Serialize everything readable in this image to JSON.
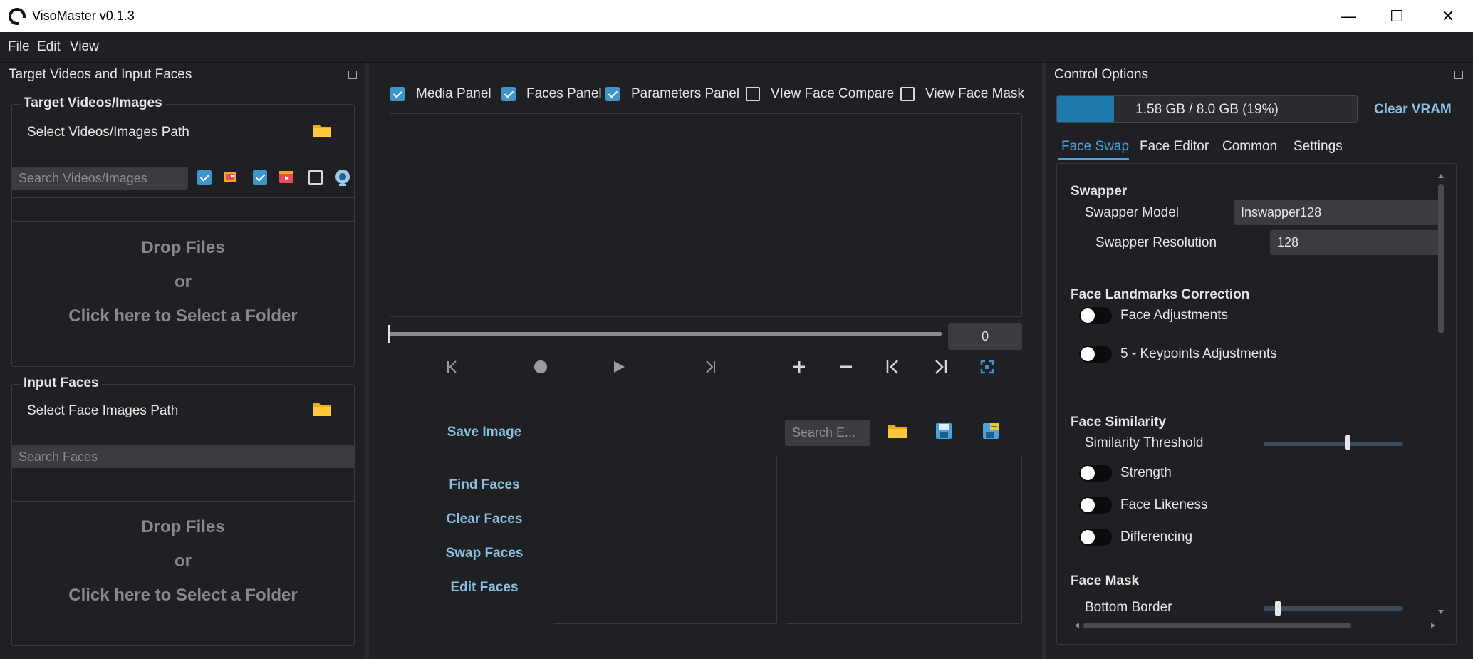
{
  "window": {
    "title": "VisoMaster v0.1.3",
    "minimize": "—",
    "maximize": "☐",
    "close": "✕"
  },
  "menu": [
    "File",
    "Edit",
    "View"
  ],
  "left_panel": {
    "title": "Target Videos and Input Faces",
    "target_group": {
      "title": "Target Videos/Images",
      "path_label": "Select Videos/Images Path"
    },
    "search_videos_placeholder": "Search Videos/Images",
    "drop": {
      "line1": "Drop Files",
      "line2": "or",
      "line3": "Click here to Select a Folder"
    },
    "faces_group": {
      "title": "Input Faces",
      "path_label": "Select Face Images Path"
    },
    "search_faces_placeholder": "Search Faces",
    "drop2": {
      "line1": "Drop Files",
      "line2": "or",
      "line3": "Click here to Select a Folder"
    }
  },
  "center": {
    "checkboxes": [
      {
        "label": "Media Panel",
        "checked": true
      },
      {
        "label": "Faces Panel",
        "checked": true
      },
      {
        "label": "Parameters Panel",
        "checked": true
      },
      {
        "label": "VIew Face Compare",
        "checked": false
      },
      {
        "label": "View Face Mask",
        "checked": false
      }
    ],
    "frame_value": "0",
    "save_image": "Save Image",
    "search_embeddings_placeholder": "Search E...",
    "find_faces": "Find Faces",
    "clear_faces": "Clear Faces",
    "swap_faces": "Swap Faces",
    "edit_faces": "Edit Faces"
  },
  "right_panel": {
    "title": "Control Options",
    "vram_text": "1.58 GB / 8.0 GB (19%)",
    "vram_fraction": 0.19,
    "clear_vram": "Clear VRAM",
    "tabs": [
      "Face Swap",
      "Face Editor",
      "Common",
      "Settings"
    ],
    "swapper": {
      "title": "Swapper",
      "model_label": "Swapper Model",
      "model_value": "Inswapper128",
      "resolution_label": "Swapper Resolution",
      "resolution_value": "128"
    },
    "landmarks": {
      "title": "Face Landmarks Correction",
      "face_adjustments": "Face Adjustments",
      "keypoints_adjustments": "5 - Keypoints Adjustments"
    },
    "similarity": {
      "title": "Face Similarity",
      "threshold_label": "Similarity Threshold",
      "threshold_level": 0.6,
      "strength": "Strength",
      "face_likeness": "Face Likeness",
      "differencing": "Differencing"
    },
    "mask": {
      "title": "Face Mask",
      "bottom_border": "Bottom Border"
    }
  },
  "colors": {
    "accent": "#3e95c9",
    "link": "#8cbfe0",
    "bg": "#1f2023",
    "vram_fill": "#1f7aad"
  }
}
